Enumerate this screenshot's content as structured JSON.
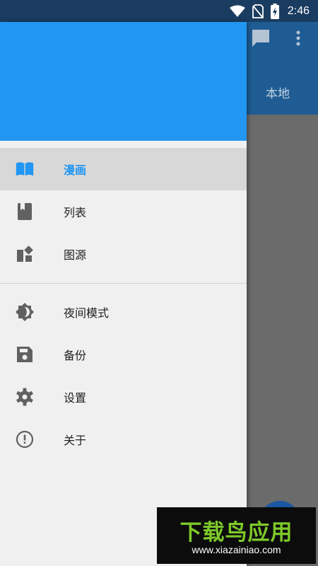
{
  "status_bar": {
    "time": "2:46",
    "icons": [
      "wifi-icon",
      "no-sim-icon",
      "battery-charging-icon"
    ]
  },
  "background_app": {
    "actions": [
      "chat-icon",
      "more-vert-icon"
    ],
    "tab_label": "本地"
  },
  "drawer": {
    "header_color": "#2196f3",
    "accent_color": "#2196f3",
    "items": [
      {
        "label": "漫画",
        "icon": "book-open-icon",
        "active": true
      },
      {
        "label": "列表",
        "icon": "bookmark-book-icon",
        "active": false
      },
      {
        "label": "图源",
        "icon": "widgets-icon",
        "active": false
      }
    ],
    "items_secondary": [
      {
        "label": "夜间模式",
        "icon": "brightness-icon",
        "active": false
      },
      {
        "label": "备份",
        "icon": "save-icon",
        "active": false
      },
      {
        "label": "设置",
        "icon": "gear-icon",
        "active": false
      },
      {
        "label": "关于",
        "icon": "info-circle-icon",
        "active": false
      }
    ]
  },
  "watermark": {
    "title": "下载鸟应用",
    "url": "www.xiazainiao.com"
  }
}
